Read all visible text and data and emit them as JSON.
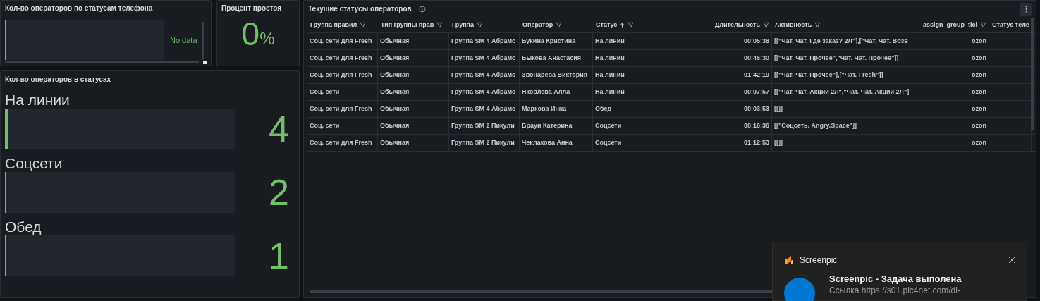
{
  "phone_panel": {
    "title": "Кол-во операторов по статусам телефона",
    "empty_text": "No data"
  },
  "idle_panel": {
    "title": "Процент простоя",
    "value": "0",
    "unit": "%"
  },
  "status_panel": {
    "title": "Кол-во операторов в статусах",
    "items": [
      {
        "label": "На линии",
        "value": "4",
        "level": 0.012
      },
      {
        "label": "Соцсети",
        "value": "2",
        "level": 0.006
      },
      {
        "label": "Обед",
        "value": "1",
        "level": 0.003
      }
    ]
  },
  "table_panel": {
    "title": "Текущие статусы операторов",
    "columns": [
      {
        "label": "Группа правил",
        "filter": true,
        "sorted": false
      },
      {
        "label": "Тип группы прав",
        "filter": true,
        "sorted": false
      },
      {
        "label": "Группа",
        "filter": true,
        "sorted": false
      },
      {
        "label": "Оператор",
        "filter": true,
        "sorted": false
      },
      {
        "label": "Статус",
        "filter": true,
        "sorted": true
      },
      {
        "label": "Длительность",
        "filter": true,
        "sorted": false
      },
      {
        "label": "Активность",
        "filter": true,
        "sorted": false
      },
      {
        "label": "assign_group_ticl",
        "filter": true,
        "sorted": false
      },
      {
        "label": "Статус теле"
      }
    ],
    "rows": [
      [
        "Соц. сети для Fresh",
        "Обычная",
        "Группа SM 4 Абрамс",
        "Букина Кристина",
        "На линии",
        "00:05:38",
        "[[\"Чат. Чат. Где заказ? 2Л\"],[\"Чат. Чат. Возв",
        "ozon"
      ],
      [
        "Соц. сети для Fresh",
        "Обычная",
        "Группа SM 4 Абрамс",
        "Быкова Анастасия",
        "На линии",
        "00:46:30",
        "[[\"Чат. Чат. Прочее\",\"Чат. Чат. Прочее\"]]",
        "ozon"
      ],
      [
        "Соц. сети для Fresh",
        "Обычная",
        "Группа SM 4 Абрамс",
        "Звонарева Виктория",
        "На линии",
        "01:42:19",
        "[[\"Чат. Чат. Прочее\"],[\"Чат. Fresh\"]]",
        "ozon"
      ],
      [
        "Соц. сети",
        "Обычная",
        "Группа SM 4 Абрамс",
        "Яковлева Алла",
        "На линии",
        "00:07:57",
        "[[\"Чат. Чат. Акции 2Л\",\"Чат. Чат. Акции 2Л\"]",
        "ozon"
      ],
      [
        "Соц. сети для Fresh",
        "Обычная",
        "Группа SM 4 Абрамс",
        "Маркова Инна",
        "Обед",
        "00:03:53",
        "[[]]",
        "ozon"
      ],
      [
        "Соц. сети",
        "Обычная",
        "Группа SM 2 Пикули",
        "Браун Катерина",
        "Соцсети",
        "00:16:36",
        "[[\"Соцсеть. Angry.Space\"]]",
        "ozon"
      ],
      [
        "Соц. сети для Fresh",
        "Обычная",
        "Группа SM 2 Пикули",
        "Чеклакова Анна",
        "Соцсети",
        "01:12:53",
        "[[]]",
        "ozon"
      ]
    ]
  },
  "notification": {
    "app": "Screenpic",
    "title": "Screenpic - Задача выполена",
    "text": "Ссылка https://s01.pic4net.com/di-"
  }
}
